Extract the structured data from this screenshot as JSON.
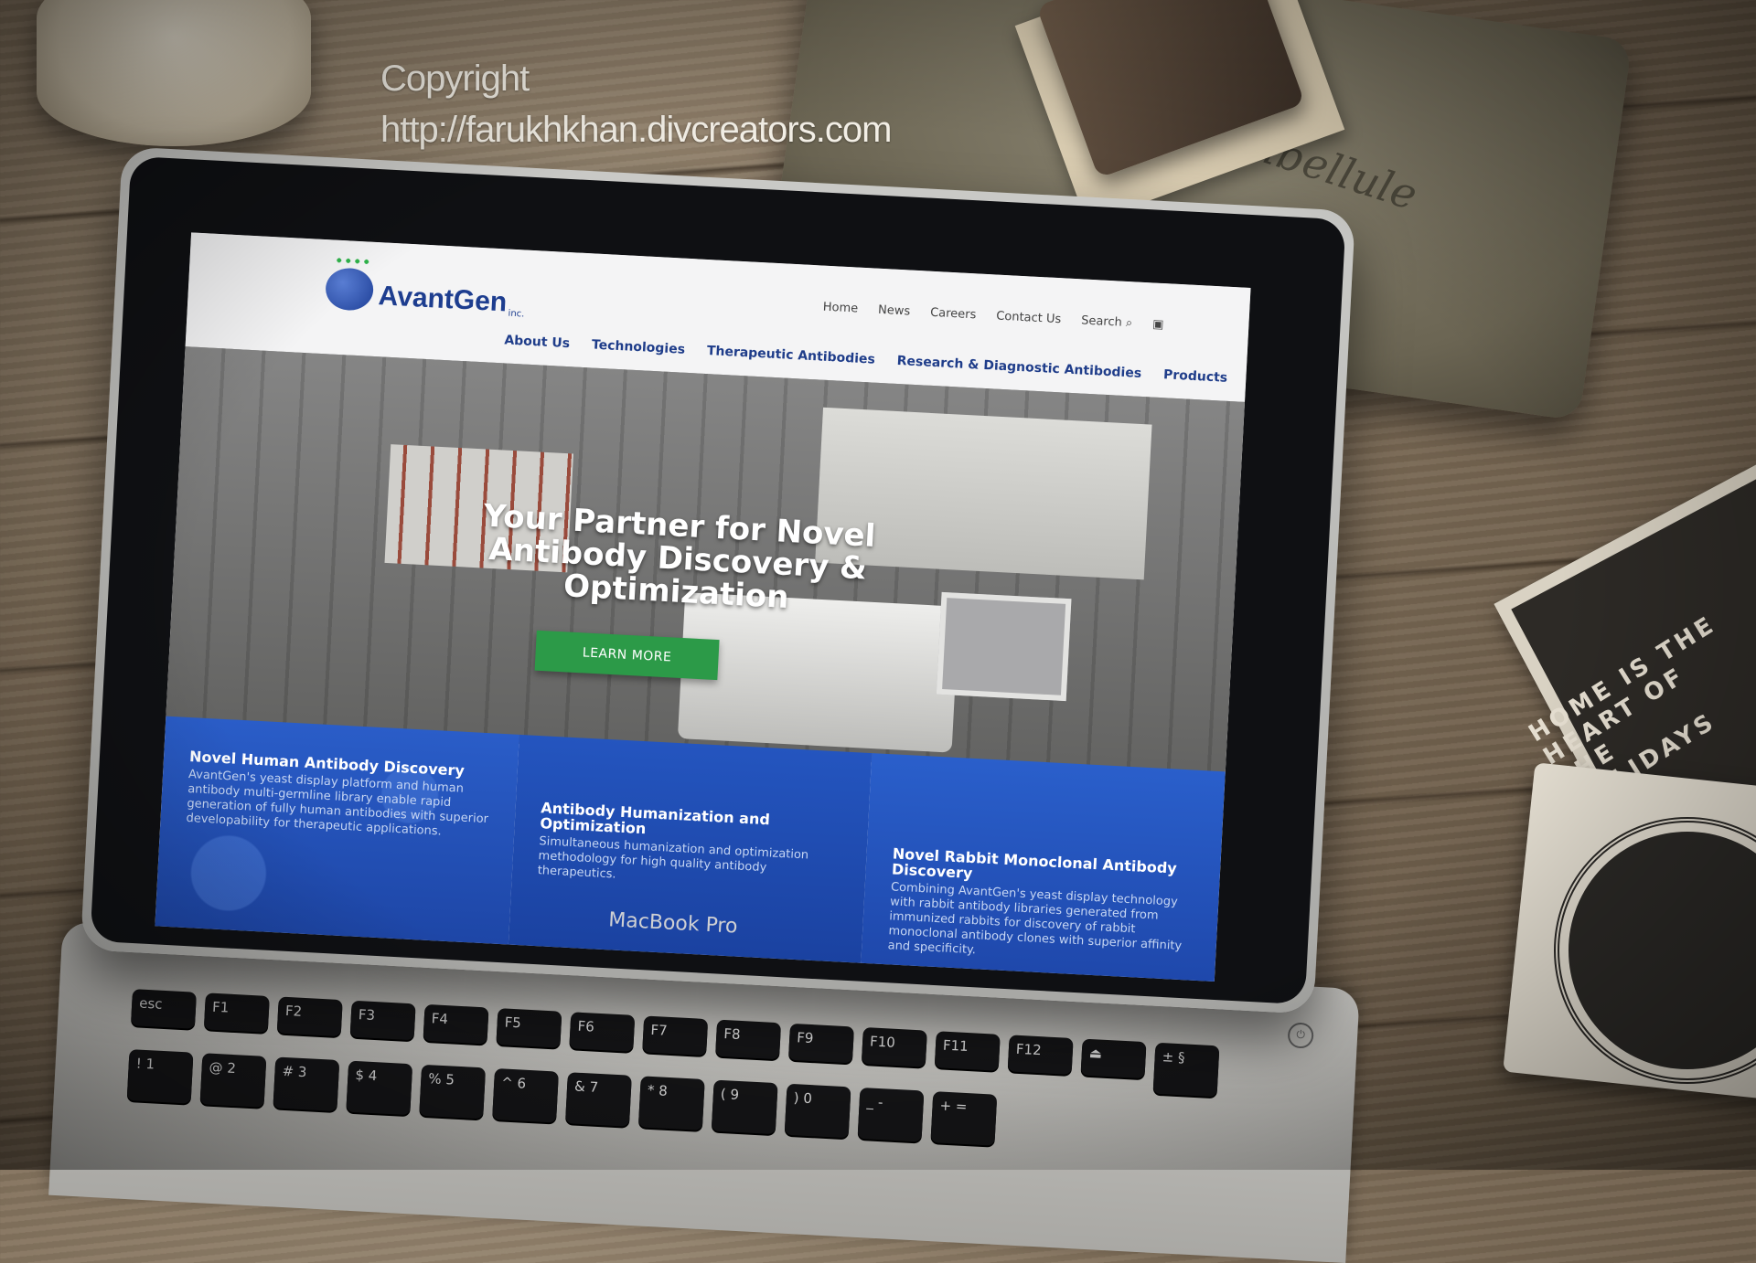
{
  "watermark": {
    "line1": "Copyright",
    "line2": "http://farukhkhan.divcreators.com"
  },
  "laptop": {
    "brand": "MacBook Pro",
    "keys": [
      "esc",
      "F1",
      "F2",
      "F3",
      "F4",
      "F5",
      "F6",
      "F7",
      "F8",
      "F9",
      "F10",
      "F11",
      "F12",
      "⏏",
      "± §",
      "! 1",
      "@ 2",
      "# 3",
      "$ 4",
      "% 5",
      "^ 6",
      "& 7",
      "* 8",
      "( 9",
      ") 0",
      "_ -",
      "+ ="
    ]
  },
  "props": {
    "pouch_text": "la libellule",
    "coaster_text": "HOME IS THE HEART OF THE HOLIDAYS"
  },
  "site": {
    "logo": {
      "name": "AvantGen",
      "suffix": "inc."
    },
    "top_nav": [
      "Home",
      "News",
      "Careers",
      "Contact Us",
      "Search"
    ],
    "main_nav": [
      "About Us",
      "Technologies",
      "Therapeutic Antibodies",
      "Research & Diagnostic Antibodies",
      "Products"
    ],
    "hero": {
      "title": "Your Partner for Novel Antibody Discovery & Optimization",
      "button": "LEARN MORE"
    },
    "features": [
      {
        "title": "Novel Human Antibody Discovery",
        "text": "AvantGen's yeast display platform and human antibody multi-germline library enable rapid generation of fully human antibodies with superior developability for therapeutic applications."
      },
      {
        "title": "Antibody Humanization and Optimization",
        "text": "Simultaneous humanization and optimization methodology for high quality antibody therapeutics."
      },
      {
        "title": "Novel Rabbit Monoclonal Antibody Discovery",
        "text": "Combining AvantGen's yeast display technology with rabbit antibody libraries generated from immunized rabbits for discovery of rabbit monoclonal antibody clones with superior affinity and specificity."
      }
    ]
  }
}
